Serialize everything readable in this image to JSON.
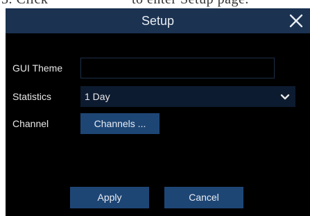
{
  "background_text": {
    "left": "3. Click",
    "right": "to enter Setup page."
  },
  "dialog": {
    "title": "Setup",
    "close_icon": "close-x-icon",
    "fields": {
      "gui_theme_label": "GUI Theme",
      "gui_theme_value": "",
      "statistics_label": "Statistics",
      "statistics_value": "1 Day",
      "channel_label": "Channel",
      "channels_button": "Channels ..."
    },
    "buttons": {
      "apply": "Apply",
      "cancel": "Cancel"
    }
  },
  "colors": {
    "titlebar": "#1b3251",
    "button": "#1e4675",
    "dialog_bg": "#000000"
  }
}
